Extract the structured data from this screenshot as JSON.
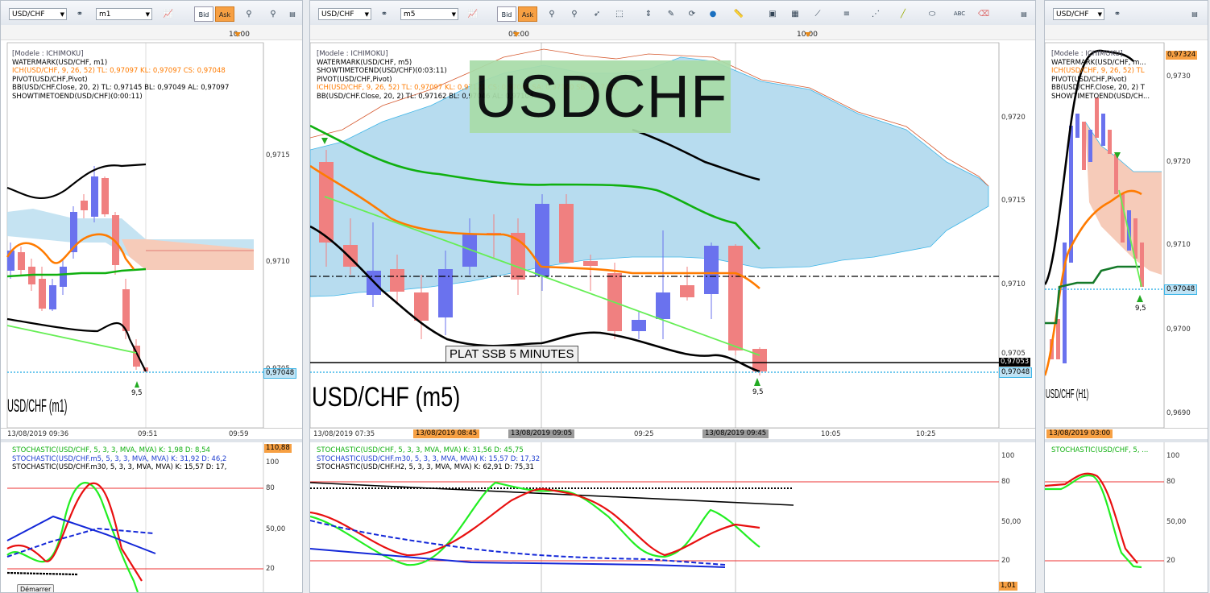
{
  "colors": {
    "bull": "#6a72ee",
    "bear": "#f08080",
    "green": "#10b010",
    "orange": "#ff7b00",
    "black": "#000000",
    "lightgreen": "#66ee55",
    "cloud": "#b7dcef",
    "cloudred": "#f6cbb9",
    "cyan": "#3fb6e8",
    "bid_bg": "#ffffff",
    "ask_bg": "#f7a043"
  },
  "panes": {
    "left": {
      "symbol": "USD/CHF",
      "tf": "m1",
      "bid": "Bid",
      "ask": "Ask",
      "timebar_label": "10:00",
      "legend": [
        "[Modele : ICHIMOKU]",
        "WATERMARK(USD/CHF, m1)",
        "ICH(USD/CHF, 9, 26, 52)  TL: 0,97097  KL: 0,97097  CS: 0,97048",
        "PIVOT(USD/CHF,Pivot)",
        "BB(USD/CHF.Close, 20, 2)  TL: 0,97145  BL: 0,97049  AL: 0,97097",
        "SHOWTIMETOEND(USD/CHF)(0:00:11)"
      ],
      "price_ticks": [
        "0,9715",
        "0,9710",
        "0,9705"
      ],
      "price_box": "0,97048",
      "watermark": "USD/CHF (m1)",
      "signal": "9,5",
      "dates": [
        "13/08/2019 09:36",
        "09:51",
        "09:59"
      ],
      "stoch_legend": [
        "STOCHASTIC(USD/CHF, 5, 3, 3, MVA, MVA)  K: 1,98  D: 8,54",
        "STOCHASTIC(USD/CHF.m5, 5, 3, 3, MVA, MVA)  K: 31,92  D: 46,2",
        "STOCHASTIC(USD/CHF.m30, 5, 3, 3, MVA, MVA)  K: 15,57  D: 17,"
      ],
      "stoch_ticks": [
        "100",
        "80",
        "50,00",
        "20"
      ],
      "stoch_top": "110,88",
      "button": "Démarrer"
    },
    "mid": {
      "symbol": "USD/CHF",
      "tf": "m5",
      "bid": "Bid",
      "ask": "Ask",
      "timebar_labels": [
        "09:00",
        "10:00"
      ],
      "legend": [
        "[Modele : ICHIMOKU]",
        "WATERMARK(USD/CHF, m5)",
        "SHOWTIMETOEND(USD/CHF)(0:03:11)",
        "PIVOT(USD/CHF,Pivot)",
        "ICH(USD/CHF, 9, 26, 52)  TL: 0,97097  KL: 0,97121  CS: 0,97048  SA: 0,97100  SB: 0,97158",
        "BB(USD/CHF.Close, 20, 2)  TL: 0,97162  BL: 0,97046  AL: 0,97104"
      ],
      "title_banner": "USDCHF",
      "annotation": "PLAT SSB 5 MINUTES",
      "watermark": "USD/CHF (m5)",
      "signal": "9,5",
      "price_ticks": [
        "0,9720",
        "0,9715",
        "0,9710",
        "0,9705"
      ],
      "price_box_black": "0,97053",
      "price_box_cyan": "0,97048",
      "dates": [
        {
          "t": "13/08/2019 07:35",
          "hl": ""
        },
        {
          "t": "13/08/2019 08:45",
          "hl": "orange"
        },
        {
          "t": "13/08/2019 09:05",
          "hl": "gray"
        },
        {
          "t": "09:25",
          "hl": ""
        },
        {
          "t": "13/08/2019 09:45",
          "hl": "gray"
        },
        {
          "t": "10:05",
          "hl": ""
        },
        {
          "t": "10:25",
          "hl": ""
        }
      ],
      "stoch_legend": [
        "STOCHASTIC(USD/CHF, 5, 3, 3, MVA, MVA)  K: 31,56  D: 45,75",
        "STOCHASTIC(USD/CHF.m30, 5, 3, 3, MVA, MVA)  K: 15,57  D: 17,32",
        "STOCHASTIC(USD/CHF.H2, 5, 3, 3, MVA, MVA)  K: 62,91  D: 75,31"
      ],
      "stoch_ticks": [
        "100",
        "80",
        "50,00",
        "20"
      ],
      "stoch_bottom": "1,01"
    },
    "right": {
      "symbol": "USD/CHF",
      "legend": [
        "[Modele : ICHIMOKU]",
        "WATERMARK(USD/CHF, m...",
        "ICH(USD/CHF, 9, 26, 52)  TL",
        "PIVOT(USD/CHF,Pivot)",
        "BB(USD/CHF.Close, 20, 2)  T",
        "SHOWTIMETOEND(USD/CH..."
      ],
      "price_ticks": [
        "0,9730",
        "0,9720",
        "0,9710",
        "0,9700",
        "0,9690"
      ],
      "price_box_top": "0,97324",
      "price_box_cyan": "0,97048",
      "watermark": "USD/CHF (H1)",
      "signal": "9,5",
      "date": "13/08/2019 03:00",
      "stoch_legend": [
        "STOCHASTIC(USD/CHF, 5, ..."
      ],
      "stoch_ticks": [
        "100",
        "80",
        "50,00",
        "20"
      ]
    }
  }
}
